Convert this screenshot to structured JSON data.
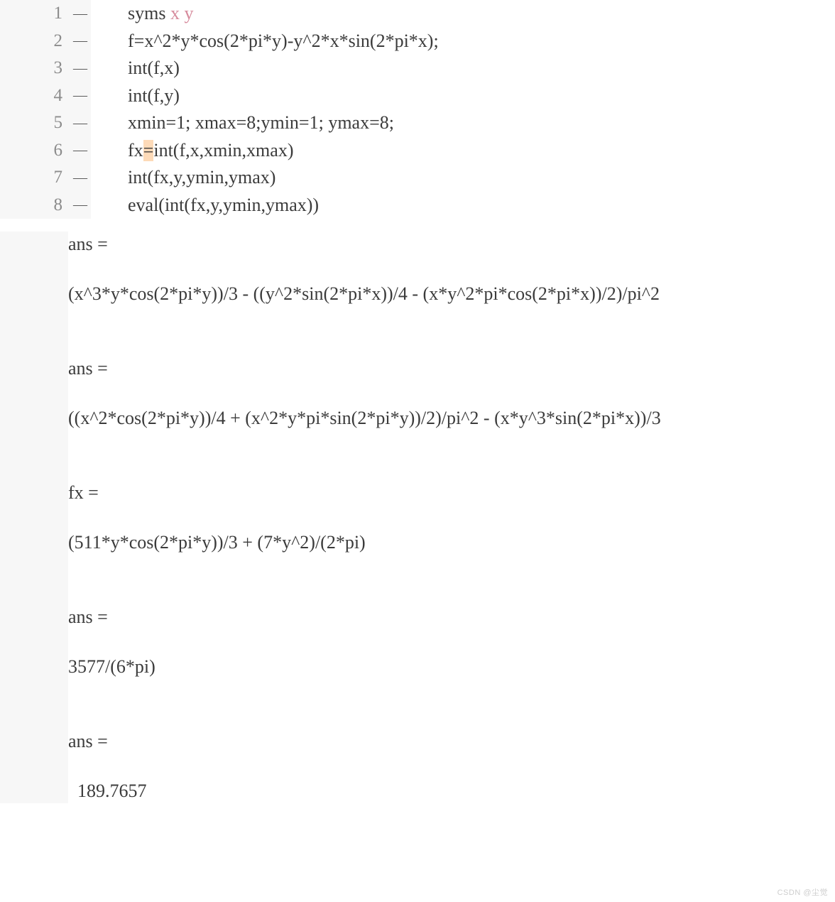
{
  "code": {
    "lines": [
      {
        "num": "1",
        "dash": "—",
        "text": [
          {
            "t": "syms ",
            "cls": ""
          },
          {
            "t": "x",
            "cls": "var"
          },
          {
            "t": " ",
            "cls": ""
          },
          {
            "t": "y",
            "cls": "var"
          }
        ]
      },
      {
        "num": "2",
        "dash": "—",
        "text": [
          {
            "t": "f=x^2*y*cos(2*pi*y)-y^2*x*sin(2*pi*x);",
            "cls": ""
          }
        ]
      },
      {
        "num": "3",
        "dash": "—",
        "text": [
          {
            "t": "int(f,x)",
            "cls": ""
          }
        ]
      },
      {
        "num": "4",
        "dash": "—",
        "text": [
          {
            "t": "int(f,y)",
            "cls": ""
          }
        ]
      },
      {
        "num": "5",
        "dash": "—",
        "text": [
          {
            "t": "xmin=1; xmax=8;ymin=1; ymax=8;",
            "cls": ""
          }
        ]
      },
      {
        "num": "6",
        "dash": "—",
        "text": [
          {
            "t": "fx",
            "cls": ""
          },
          {
            "t": "=",
            "cls": "highlight"
          },
          {
            "t": "int(f,x,xmin,xmax)",
            "cls": ""
          }
        ]
      },
      {
        "num": "7",
        "dash": "—",
        "text": [
          {
            "t": "int(fx,y,ymin,ymax)",
            "cls": ""
          }
        ]
      },
      {
        "num": "8",
        "dash": "—",
        "text": [
          {
            "t": "eval(int(fx,y,ymin,ymax))",
            "cls": ""
          }
        ]
      }
    ]
  },
  "output": {
    "lines": [
      "ans =",
      "",
      "(x^3*y*cos(2*pi*y))/3 - ((y^2*sin(2*pi*x))/4 - (x*y^2*pi*cos(2*pi*x))/2)/pi^2",
      "",
      "",
      "ans =",
      "",
      "((x^2*cos(2*pi*y))/4 + (x^2*y*pi*sin(2*pi*y))/2)/pi^2 - (x*y^3*sin(2*pi*x))/3",
      "",
      "",
      "fx =",
      "",
      "(511*y*cos(2*pi*y))/3 + (7*y^2)/(2*pi)",
      "",
      "",
      "ans =",
      "",
      "3577/(6*pi)",
      "",
      "",
      "ans =",
      "",
      "  189.7657"
    ]
  },
  "watermark": "CSDN @尘觉"
}
